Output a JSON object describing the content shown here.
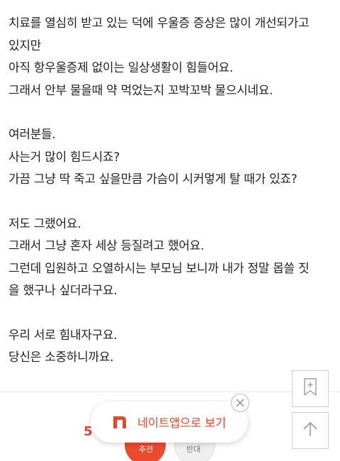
{
  "article": {
    "paragraphs": [
      {
        "lines": [
          "치료를 열심히 받고 있는 덕에 우울증 증상은 많이 개선되가고",
          "있지만",
          "아직 항우울증제 없이는 일상생활이 힘들어요.",
          "그래서 안부 물을때 약 먹었는지 꼬박꼬박 물으시네요."
        ]
      },
      {
        "lines": [
          "여러분들.",
          "사는거 많이 힘드시죠?",
          "가끔 그냥 딱 죽고 싶을만큼 가슴이 시커멓게 탈 때가 있죠?"
        ]
      },
      {
        "lines": [
          "저도 그랬어요.",
          "그래서 그냥 혼자 세상 등질려고 했어요.",
          "그런데 입원하고 오열하시는 부모님 보니까 내가 정말 몹쓸 짓",
          "을 했구나 싶더라구요."
        ]
      },
      {
        "lines": [
          "우리 서로 힘내자구요.",
          "당신은 소중하니까요."
        ]
      }
    ]
  },
  "bottom_bar": {
    "count": "5",
    "red_button_label": "추천",
    "gray_button_label": "반대"
  },
  "banner": {
    "text": "네이트앱으로 보기",
    "logo_icon": "nate-n-logo-icon",
    "close_icon": "close-icon",
    "accent_color": "#e5462d"
  },
  "side_buttons": {
    "bookmark_icon": "bookmark-add-icon",
    "top_icon": "arrow-up-icon"
  }
}
